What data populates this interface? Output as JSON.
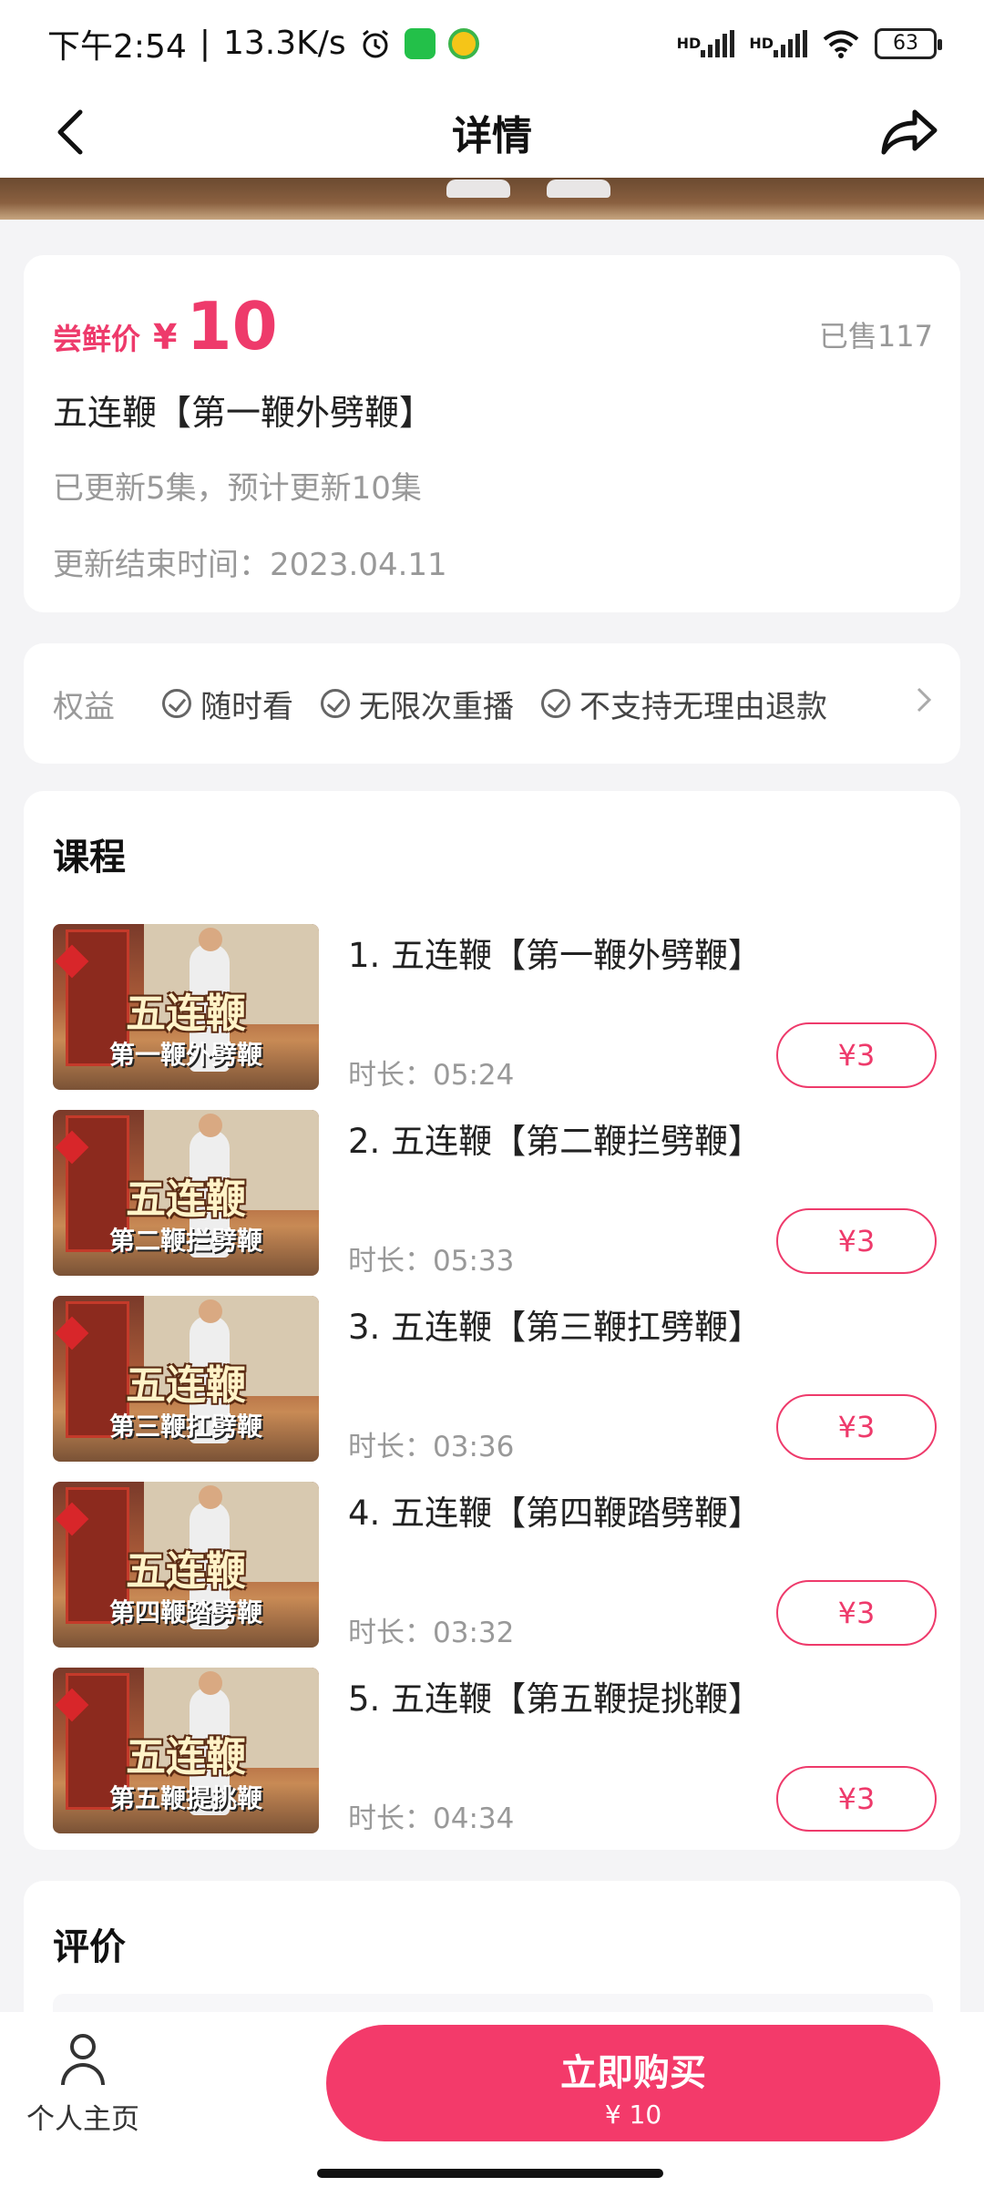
{
  "status_bar": {
    "time": "下午2:54",
    "network_speed": "13.3K/s",
    "hd1": "HD",
    "hd2": "HD",
    "battery": "63"
  },
  "header": {
    "title": "详情"
  },
  "product": {
    "price_label": "尝鲜价",
    "currency": "¥",
    "price": "10",
    "sold": "已售117",
    "title": "五连鞭【第一鞭外劈鞭】",
    "update_info": "已更新5集，预计更新10集",
    "end_time": "更新结束时间：2023.04.11"
  },
  "rights": {
    "label": "权益",
    "items": [
      "随时看",
      "无限次重播",
      "不支持无理由退款"
    ]
  },
  "courses": {
    "section_title": "课程",
    "lessons": [
      {
        "title": "1. 五连鞭【第一鞭外劈鞭】",
        "duration": "时长：05:24",
        "price": "¥3",
        "thumb_big": "五连鞭",
        "thumb_sub": "第一鞭外劈鞭"
      },
      {
        "title": "2. 五连鞭【第二鞭拦劈鞭】",
        "duration": "时长：05:33",
        "price": "¥3",
        "thumb_big": "五连鞭",
        "thumb_sub": "第二鞭拦劈鞭"
      },
      {
        "title": "3. 五连鞭【第三鞭扛劈鞭】",
        "duration": "时长：03:36",
        "price": "¥3",
        "thumb_big": "五连鞭",
        "thumb_sub": "第三鞭扛劈鞭"
      },
      {
        "title": "4. 五连鞭【第四鞭踏劈鞭】",
        "duration": "时长：03:32",
        "price": "¥3",
        "thumb_big": "五连鞭",
        "thumb_sub": "第四鞭踏劈鞭"
      },
      {
        "title": "5. 五连鞭【第五鞭提挑鞭】",
        "duration": "时长：04:34",
        "price": "¥3",
        "thumb_big": "五连鞭",
        "thumb_sub": "第五鞭提挑鞭"
      }
    ]
  },
  "reviews": {
    "section_title": "评价"
  },
  "bottom_bar": {
    "profile_label": "个人主页",
    "buy_label": "立即购买",
    "buy_price": "¥ 10"
  },
  "colors": {
    "accent": "#ee3a6b",
    "buy_button": "#f33a6a",
    "background": "#f4f4f6"
  },
  "icons": {
    "back": "back-arrow-icon",
    "share": "share-icon",
    "alarm": "alarm-icon",
    "wechat": "wechat-icon",
    "wifi": "wifi-icon",
    "check": "check-circle-icon",
    "chevron": "chevron-right-icon",
    "profile": "person-icon"
  }
}
